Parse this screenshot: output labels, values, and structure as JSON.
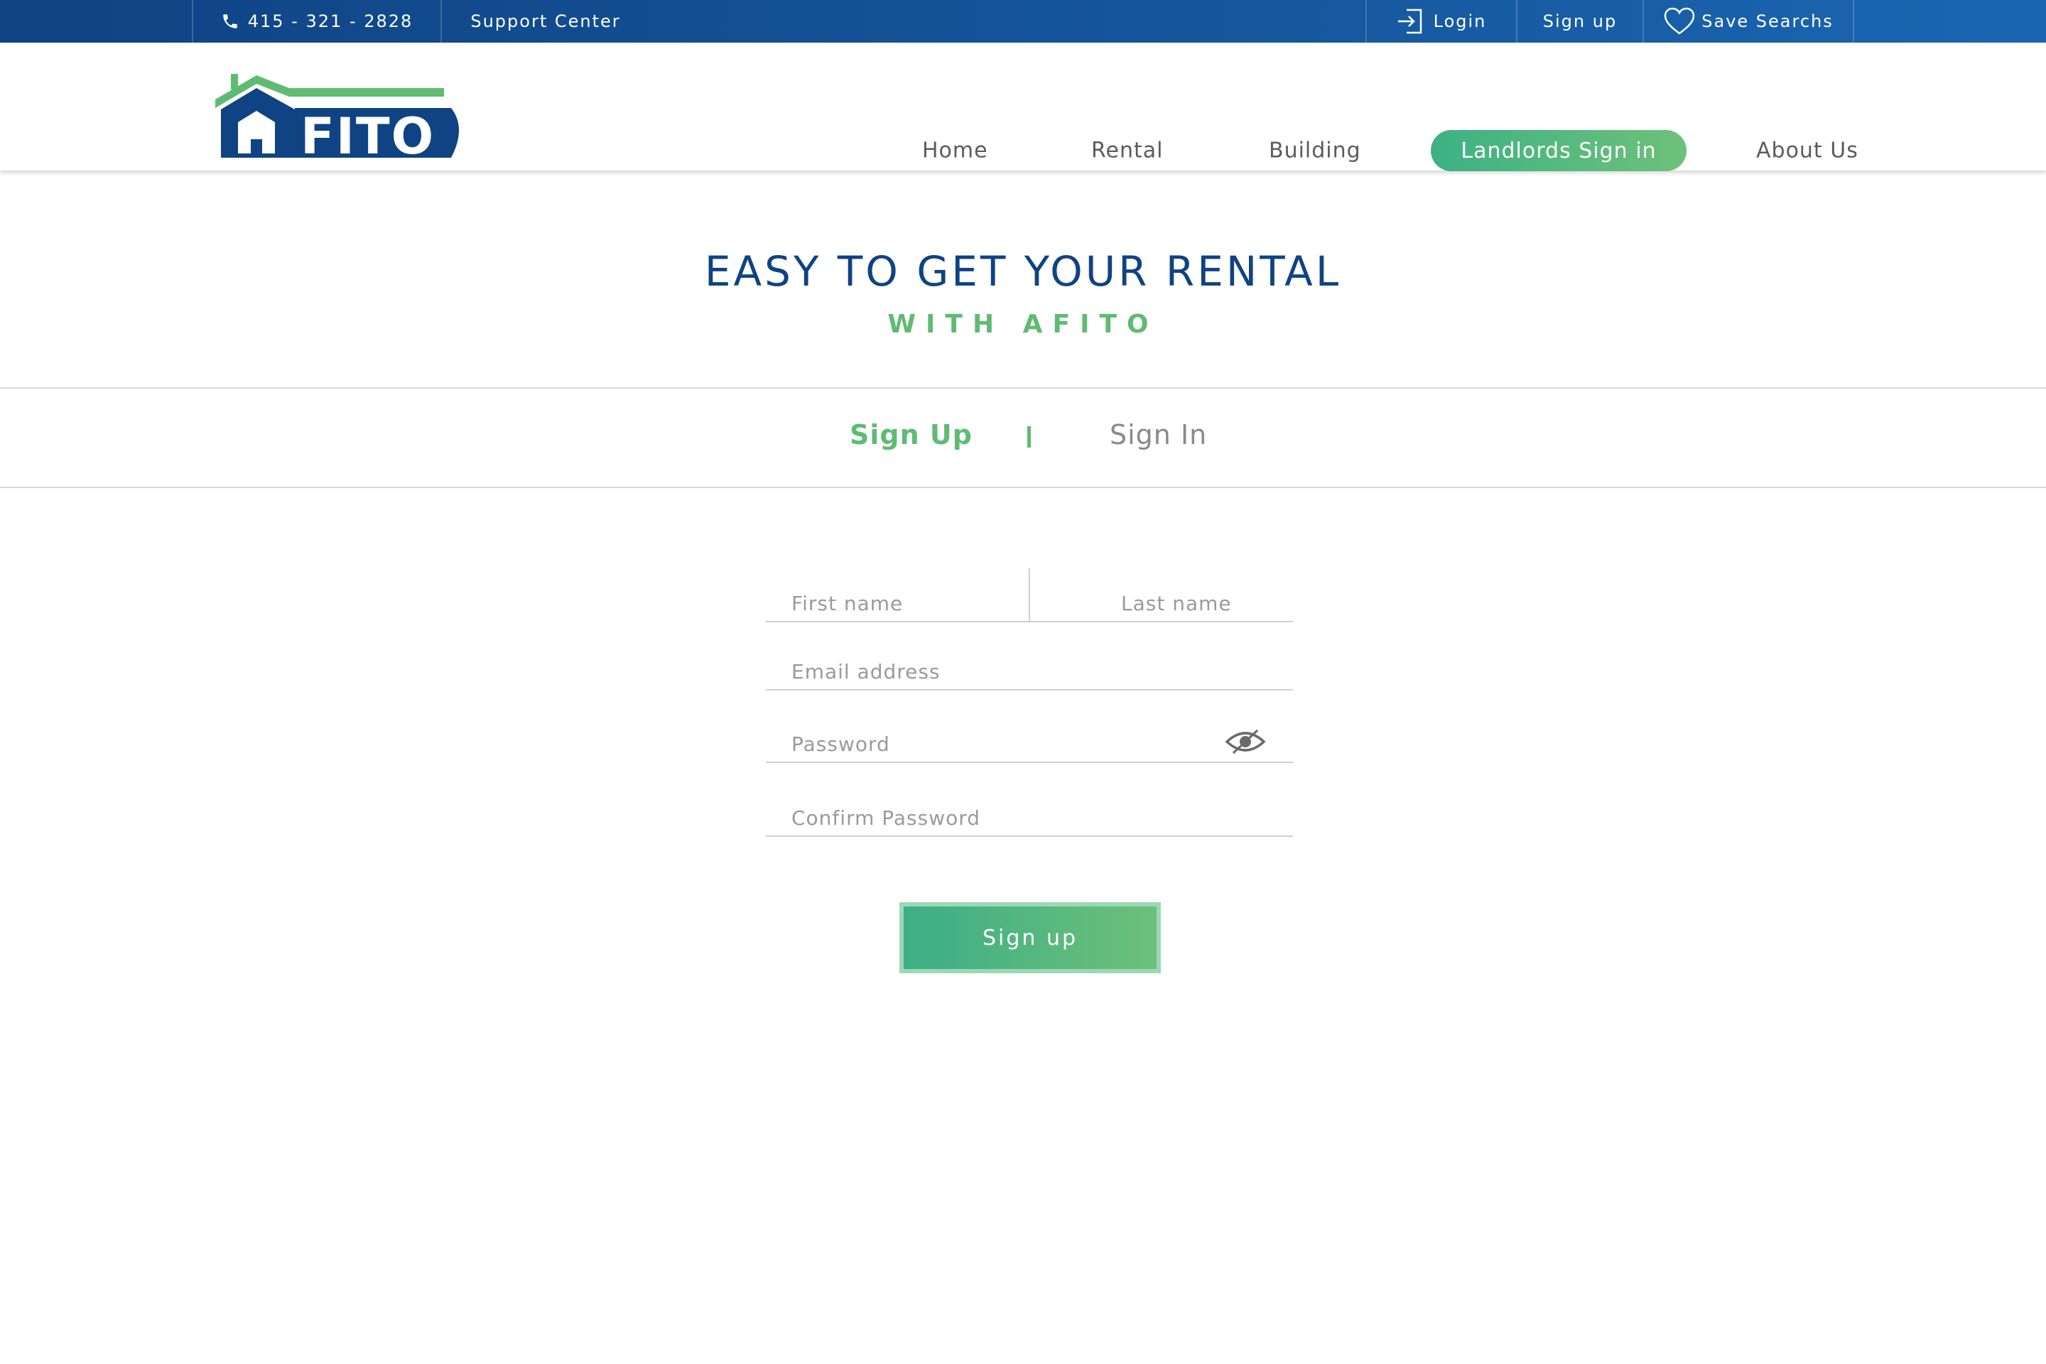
{
  "topbar": {
    "phone": "415 - 321 - 2828",
    "support": "Support Center",
    "login": "Login",
    "signup": "Sign up",
    "save_searches": "Save Searchs"
  },
  "nav": {
    "logo_text": "AFITO",
    "home": "Home",
    "rental": "Rental",
    "building": "Building",
    "landlords": "Landlords Sign in",
    "about": "About Us"
  },
  "hero": {
    "title": "EASY TO GET YOUR RENTAL",
    "subtitle": "WITH AFITO"
  },
  "tabs": {
    "signup": "Sign Up",
    "signin": "Sign In"
  },
  "form": {
    "first_name": "First name",
    "last_name": "Last name",
    "email": "Email address",
    "password": "Password",
    "confirm_password": "Confirm Password",
    "submit": "Sign up"
  },
  "colors": {
    "brand_blue": "#0f4383",
    "brand_green": "#5fbb73",
    "cta_gradient_start": "#3db184",
    "cta_gradient_end": "#6ec17a"
  },
  "icons": {
    "phone": "phone-icon",
    "login": "login-icon",
    "save": "heart-icon",
    "password_toggle": "eye-icon",
    "logo": "house-logo"
  }
}
